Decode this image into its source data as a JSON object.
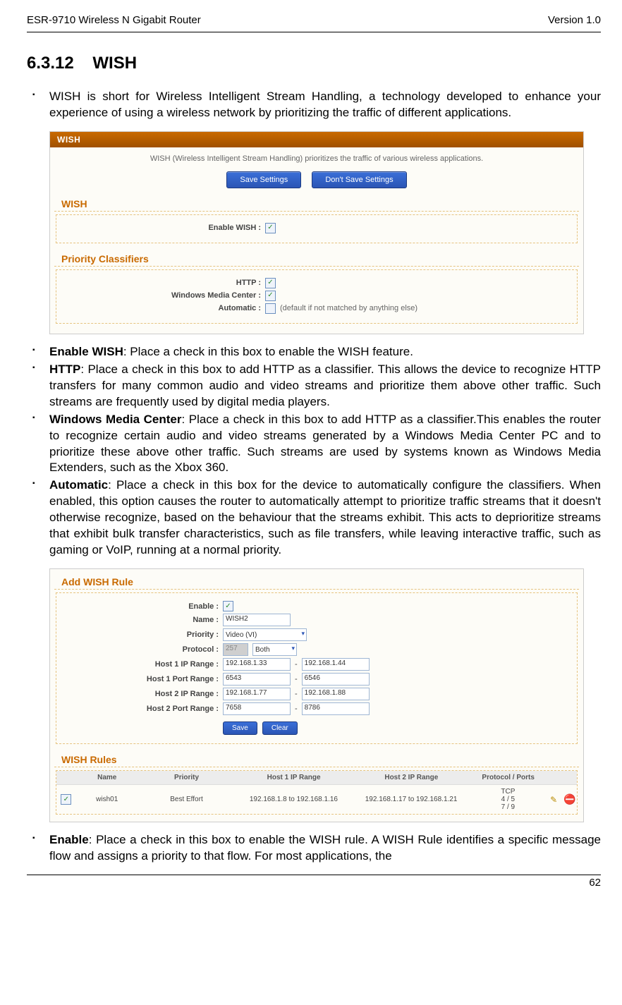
{
  "header": {
    "left": "ESR-9710 Wireless N Gigabit Router",
    "right": "Version 1.0"
  },
  "section": {
    "number": "6.3.12",
    "title": "WISH"
  },
  "intro": "WISH is short for Wireless Intelligent Stream Handling, a technology developed to enhance your experience of using a wireless network by prioritizing the traffic of different applications.",
  "panel1": {
    "head": "WISH",
    "desc": "WISH (Wireless Intelligent Stream Handling) prioritizes the traffic of various wireless applications.",
    "btnSave": "Save Settings",
    "btnDont": "Don't Save Settings",
    "sub_wish": "WISH",
    "lbl_enable": "Enable WISH :",
    "sub_pc": "Priority Classifiers",
    "lbl_http": "HTTP :",
    "lbl_wmc": "Windows Media Center :",
    "lbl_auto": "Automatic :",
    "auto_note": "(default if not matched by anything else)"
  },
  "bullets1": {
    "b1_t": "Enable WISH",
    "b1_d": ": Place a check in this box to enable the WISH feature.",
    "b2_t": "HTTP",
    "b2_d": ":  Place a check in this box to add HTTP as a classifier. This allows the device to recognize HTTP transfers for many common audio and video streams and prioritize them above other traffic. Such streams are frequently used by digital media players.",
    "b3_t": "Windows Media Center",
    "b3_d": ": Place a check in this box to add HTTP as a classifier.This enables the router to recognize certain audio and video streams generated by a Windows Media Center PC and to prioritize these above other traffic. Such streams are used by systems known as Windows Media Extenders, such as the Xbox 360.",
    "b4_t": "Automatic",
    "b4_d": ": Place a check in this box for the device to automatically configure the classifiers. When enabled, this option causes the router to automatically attempt to prioritize traffic streams that it doesn't otherwise recognize, based on the behaviour that the streams exhibit. This acts to deprioritize streams that exhibit bulk transfer characteristics, such as file transfers, while leaving interactive traffic, such as gaming or VoIP, running at a normal priority."
  },
  "panel2": {
    "sub_add": "Add WISH Rule",
    "lbl_enable": "Enable :",
    "lbl_name": "Name :",
    "v_name": "WISH2",
    "lbl_pri": "Priority :",
    "v_pri": "Video (VI)",
    "lbl_proto": "Protocol :",
    "v_proto_num": "257",
    "v_proto": "Both",
    "lbl_h1ip": "Host 1 IP Range :",
    "v_h1a": "192.168.1.33",
    "v_h1b": "192.168.1.44",
    "lbl_h1pr": "Host 1 Port Range :",
    "v_h1pa": "6543",
    "v_h1pb": "6546",
    "lbl_h2ip": "Host 2 IP Range :",
    "v_h2a": "192.168.1.77",
    "v_h2b": "192.168.1.88",
    "lbl_h2pr": "Host 2 Port Range :",
    "v_h2pa": "7658",
    "v_h2pb": "8786",
    "btn_save": "Save",
    "btn_clear": "Clear",
    "sub_rules": "WISH Rules",
    "th_name": "Name",
    "th_pri": "Priority",
    "th_h1": "Host 1 IP Range",
    "th_h2": "Host 2 IP Range",
    "th_pp": "Protocol / Ports",
    "row": {
      "name": "wish01",
      "pri": "Best Effort",
      "h1": "192.168.1.8 to 192.168.1.16",
      "h2": "192.168.1.17 to 192.168.1.21",
      "pp": "TCP\n4 / 5\n7 / 9"
    }
  },
  "bullets2": {
    "b1_t": "Enable",
    "b1_d": ": Place a check in this box to enable the WISH rule. A WISH Rule identifies a specific message flow and assigns a priority to that flow. For most applications, the"
  },
  "pageNumber": "62"
}
